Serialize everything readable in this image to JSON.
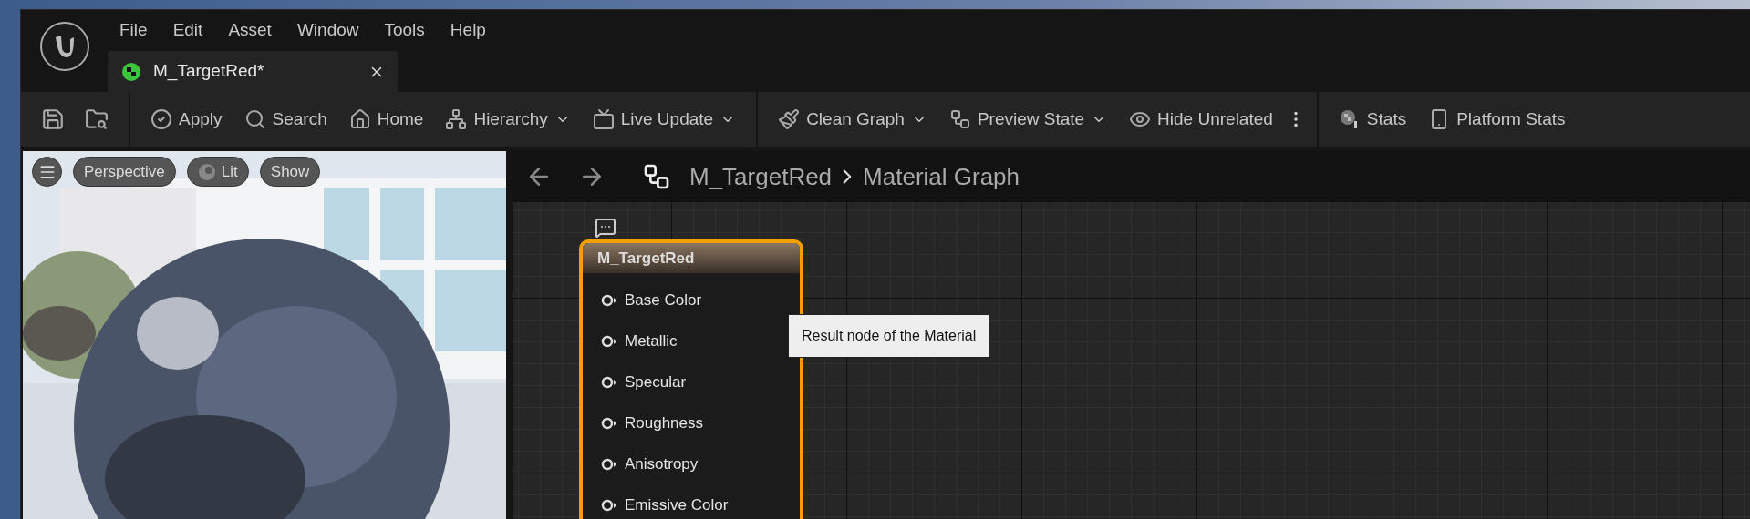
{
  "menu": [
    "File",
    "Edit",
    "Asset",
    "Window",
    "Tools",
    "Help"
  ],
  "tabs": [
    {
      "label": "M_TargetRed*",
      "selected": true
    }
  ],
  "toolbar": {
    "groups": [
      {
        "items": [
          {
            "label": "Apply",
            "dropdown": false
          },
          {
            "label": "Search",
            "dropdown": false
          },
          {
            "label": "Home",
            "dropdown": false
          },
          {
            "label": "Hierarchy",
            "dropdown": true
          },
          {
            "label": "Live Update",
            "dropdown": true
          }
        ]
      },
      {
        "items": [
          {
            "label": "Clean Graph",
            "dropdown": true
          },
          {
            "label": "Preview State",
            "dropdown": true
          },
          {
            "label": "Hide Unrelated",
            "dropdown": false
          }
        ]
      },
      {
        "items": [
          {
            "label": "Stats",
            "dropdown": false
          },
          {
            "label": "Platform Stats",
            "dropdown": false
          }
        ]
      }
    ]
  },
  "viewport": {
    "buttons": [
      "Perspective",
      "Lit",
      "Show"
    ]
  },
  "graph": {
    "breadcrumb": [
      "M_TargetRed",
      "Material Graph"
    ],
    "node": {
      "title": "M_TargetRed",
      "selected": true,
      "pins": [
        "Base Color",
        "Metallic",
        "Specular",
        "Roughness",
        "Anisotropy",
        "Emissive Color"
      ]
    },
    "tooltip": "Result node of the Material"
  }
}
